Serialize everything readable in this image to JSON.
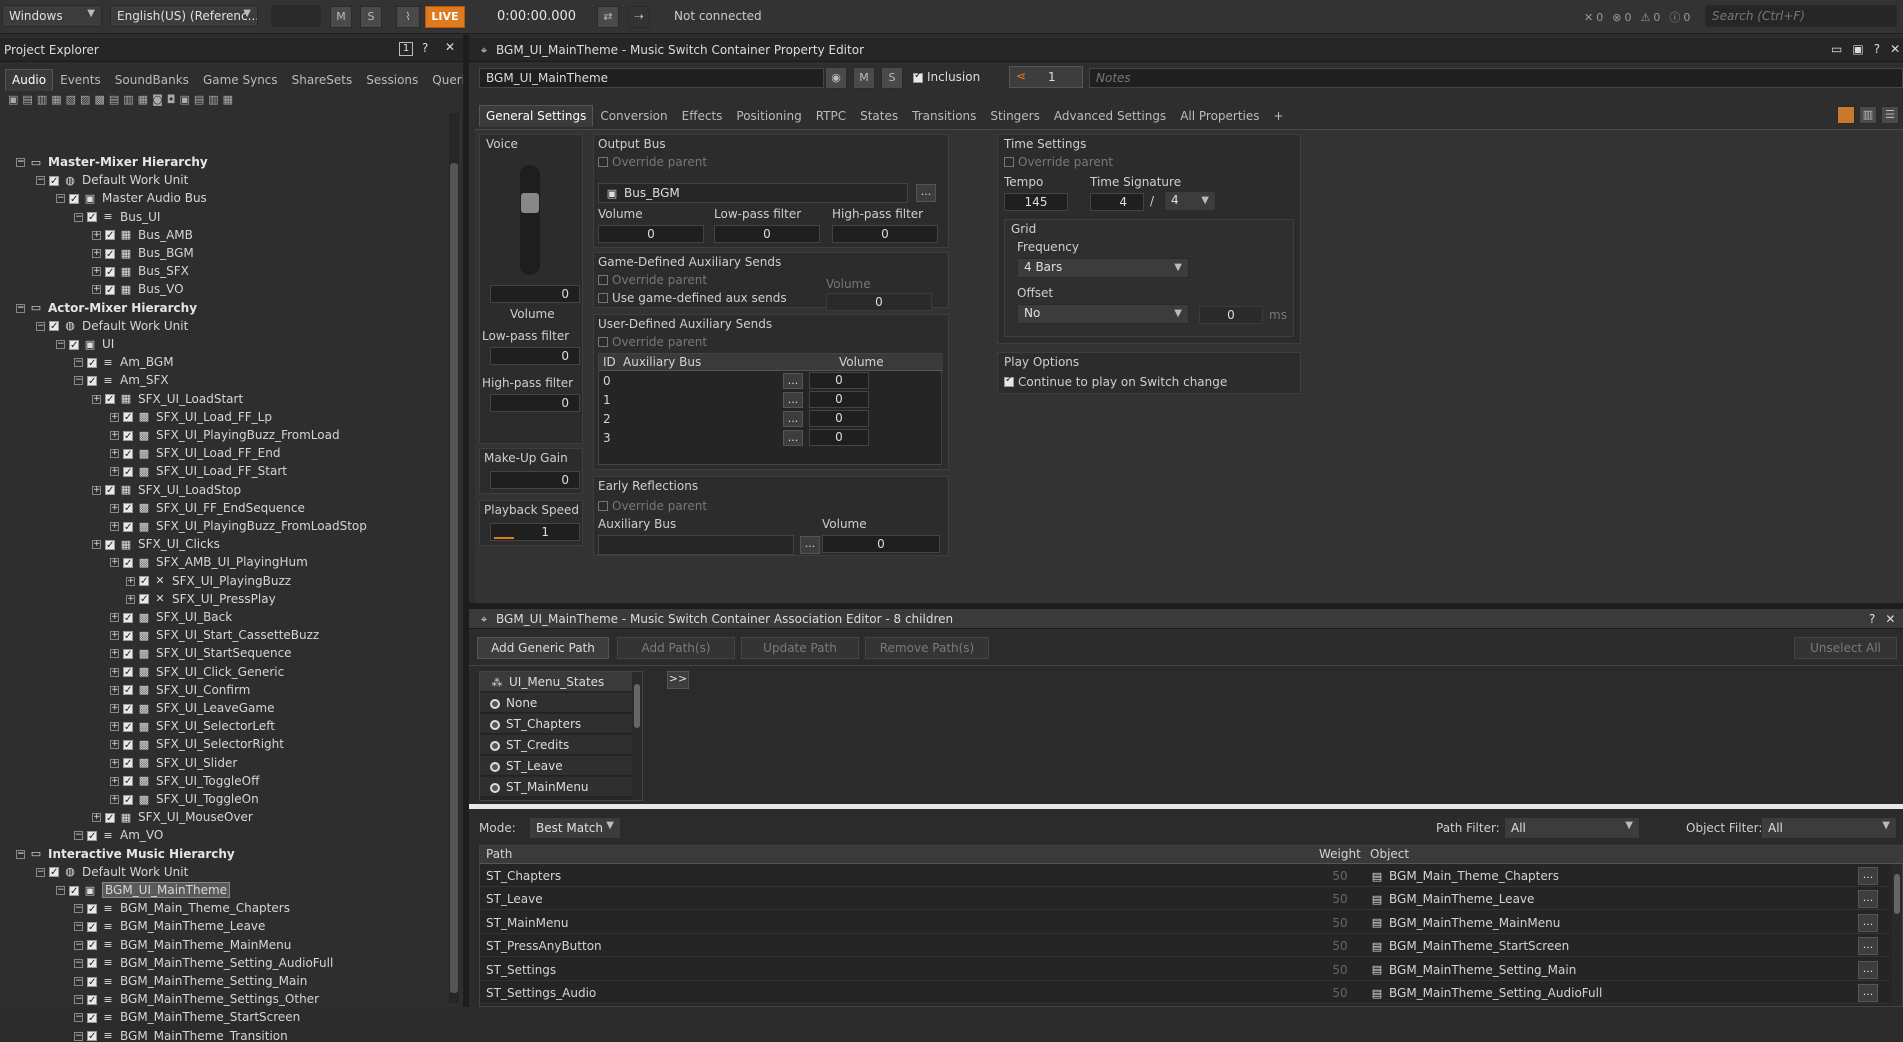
{
  "topbar": {
    "platform": "Windows",
    "language": "English(US) (Referenc...",
    "m": "M",
    "s": "S",
    "live": "LIVE",
    "time": "0:00:00.000",
    "status": "Not connected",
    "counts": [
      "0",
      "0",
      "0",
      "0"
    ],
    "search_placeholder": "Search (Ctrl+F)"
  },
  "explorer": {
    "title": "Project Explorer",
    "badge": "1",
    "tabs": [
      "Audio",
      "Events",
      "SoundBanks",
      "Game Syncs",
      "ShareSets",
      "Sessions",
      "Queries"
    ],
    "tree": [
      {
        "label": "Master-Mixer Hierarchy",
        "level": 0,
        "hdr": true
      },
      {
        "label": "Default Work Unit",
        "level": 1
      },
      {
        "label": "Master Audio Bus",
        "level": 2
      },
      {
        "label": "Bus_UI",
        "level": 3
      },
      {
        "label": "Bus_AMB",
        "level": 4
      },
      {
        "label": "Bus_BGM",
        "level": 4
      },
      {
        "label": "Bus_SFX",
        "level": 4
      },
      {
        "label": "Bus_VO",
        "level": 4
      },
      {
        "label": "Actor-Mixer Hierarchy",
        "level": 0,
        "hdr": true
      },
      {
        "label": "Default Work Unit",
        "level": 1
      },
      {
        "label": "UI",
        "level": 2
      },
      {
        "label": "Am_BGM",
        "level": 3
      },
      {
        "label": "Am_SFX",
        "level": 3
      },
      {
        "label": "SFX_UI_LoadStart",
        "level": 4
      },
      {
        "label": "SFX_UI_Load_FF_Lp",
        "level": 5
      },
      {
        "label": "SFX_UI_PlayingBuzz_FromLoad",
        "level": 5
      },
      {
        "label": "SFX_UI_Load_FF_End",
        "level": 5
      },
      {
        "label": "SFX_UI_Load_FF_Start",
        "level": 5
      },
      {
        "label": "SFX_UI_LoadStop",
        "level": 4
      },
      {
        "label": "SFX_UI_FF_EndSequence",
        "level": 5
      },
      {
        "label": "SFX_UI_PlayingBuzz_FromLoadStop",
        "level": 5
      },
      {
        "label": "SFX_UI_Clicks",
        "level": 4
      },
      {
        "label": "SFX_AMB_UI_PlayingHum",
        "level": 5
      },
      {
        "label": "SFX_UI_PlayingBuzz",
        "level": 6
      },
      {
        "label": "SFX_UI_PressPlay",
        "level": 6
      },
      {
        "label": "SFX_UI_Back",
        "level": 5
      },
      {
        "label": "SFX_UI_Start_CassetteBuzz",
        "level": 5
      },
      {
        "label": "SFX_UI_StartSequence",
        "level": 5
      },
      {
        "label": "SFX_UI_Click_Generic",
        "level": 5
      },
      {
        "label": "SFX_UI_Confirm",
        "level": 5
      },
      {
        "label": "SFX_UI_LeaveGame",
        "level": 5
      },
      {
        "label": "SFX_UI_SelectorLeft",
        "level": 5
      },
      {
        "label": "SFX_UI_SelectorRight",
        "level": 5
      },
      {
        "label": "SFX_UI_Slider",
        "level": 5
      },
      {
        "label": "SFX_UI_ToggleOff",
        "level": 5
      },
      {
        "label": "SFX_UI_ToggleOn",
        "level": 5
      },
      {
        "label": "SFX_UI_MouseOver",
        "level": 4
      },
      {
        "label": "Am_VO",
        "level": 3
      },
      {
        "label": "Interactive Music Hierarchy",
        "level": 0,
        "hdr": true
      },
      {
        "label": "Default Work Unit",
        "level": 1
      },
      {
        "label": "BGM_UI_MainTheme",
        "level": 2,
        "selected": true
      },
      {
        "label": "BGM_Main_Theme_Chapters",
        "level": 3
      },
      {
        "label": "BGM_MainTheme_Leave",
        "level": 3
      },
      {
        "label": "BGM_MainTheme_MainMenu",
        "level": 3
      },
      {
        "label": "BGM_MainTheme_Setting_AudioFull",
        "level": 3
      },
      {
        "label": "BGM_MainTheme_Setting_Main",
        "level": 3
      },
      {
        "label": "BGM_MainTheme_Settings_Other",
        "level": 3
      },
      {
        "label": "BGM_MainTheme_StartScreen",
        "level": 3
      },
      {
        "label": "BGM_MainTheme_Transition",
        "level": 3
      }
    ]
  },
  "props": {
    "title": "BGM_UI_MainTheme - Music Switch Container Property Editor",
    "name": "BGM_UI_MainTheme",
    "m": "M",
    "s": "S",
    "inclusion": "Inclusion",
    "count": "1",
    "notes_placeholder": "Notes",
    "tabs": [
      "General Settings",
      "Conversion",
      "Effects",
      "Positioning",
      "RTPC",
      "States",
      "Transitions",
      "Stingers",
      "Advanced Settings",
      "All Properties",
      "+"
    ],
    "voice": {
      "title": "Voice",
      "volume_value": "0",
      "volume_label": "Volume",
      "lpf_label": "Low-pass filter",
      "lpf_value": "0",
      "hpf_label": "High-pass filter",
      "hpf_value": "0",
      "makeup_label": "Make-Up Gain",
      "makeup_value": "0",
      "speed_label": "Playback Speed",
      "speed_value": "1"
    },
    "output_bus": {
      "title": "Output Bus",
      "override": "Override parent",
      "bus": "Bus_BGM",
      "volume_label": "Volume",
      "volume_value": "0",
      "lpf_label": "Low-pass filter",
      "lpf_value": "0",
      "hpf_label": "High-pass filter",
      "hpf_value": "0"
    },
    "game_aux": {
      "title": "Game-Defined Auxiliary Sends",
      "override": "Override parent",
      "use": "Use game-defined aux sends",
      "volume_label": "Volume",
      "volume_value": "0"
    },
    "user_aux": {
      "title": "User-Defined Auxiliary Sends",
      "override": "Override parent",
      "columns": [
        "ID",
        "Auxiliary Bus",
        "Volume"
      ],
      "rows": [
        {
          "id": "0",
          "bus": "",
          "volume": "0"
        },
        {
          "id": "1",
          "bus": "",
          "volume": "0"
        },
        {
          "id": "2",
          "bus": "",
          "volume": "0"
        },
        {
          "id": "3",
          "bus": "",
          "volume": "0"
        }
      ]
    },
    "early": {
      "title": "Early Reflections",
      "override": "Override parent",
      "bus_label": "Auxiliary Bus",
      "volume_label": "Volume",
      "volume_value": "0"
    },
    "time": {
      "title": "Time Settings",
      "override": "Override parent",
      "tempo_label": "Tempo",
      "tempo": "145",
      "sig_label": "Time Signature",
      "sig_num": "4",
      "sig_sep": "/",
      "sig_den": "4",
      "grid_title": "Grid",
      "freq_label": "Frequency",
      "freq": "4 Bars",
      "offset_label": "Offset",
      "offset": "No",
      "offset_value": "0",
      "offset_unit": "ms"
    },
    "play": {
      "title": "Play Options",
      "continue": "Continue to play on Switch change"
    }
  },
  "assoc": {
    "title": "BGM_UI_MainTheme - Music Switch Container Association Editor - 8 children",
    "buttons": [
      "Add Generic Path",
      "Add Path(s)",
      "Update Path",
      "Remove Path(s)"
    ],
    "unselect": "Unselect All",
    "arrow": ">>",
    "group": "UI_Menu_States",
    "states": [
      "None",
      "ST_Chapters",
      "ST_Credits",
      "ST_Leave",
      "ST_MainMenu"
    ],
    "mode_label": "Mode:",
    "mode": "Best Match",
    "path_filter_label": "Path Filter:",
    "path_filter": "All",
    "object_filter_label": "Object Filter:",
    "object_filter": "All",
    "columns": [
      "Path",
      "Weight",
      "Object"
    ],
    "rows": [
      {
        "path": "ST_Chapters",
        "weight": "50",
        "object": "BGM_Main_Theme_Chapters"
      },
      {
        "path": "ST_Leave",
        "weight": "50",
        "object": "BGM_MainTheme_Leave"
      },
      {
        "path": "ST_MainMenu",
        "weight": "50",
        "object": "BGM_MainTheme_MainMenu"
      },
      {
        "path": "ST_PressAnyButton",
        "weight": "50",
        "object": "BGM_MainTheme_StartScreen"
      },
      {
        "path": "ST_Settings",
        "weight": "50",
        "object": "BGM_MainTheme_Setting_Main"
      },
      {
        "path": "ST_Settings_Audio",
        "weight": "50",
        "object": "BGM_MainTheme_Setting_AudioFull"
      }
    ]
  },
  "colors": {
    "accent": "#e07a1f",
    "selected_tab": "#3a3a3a"
  }
}
